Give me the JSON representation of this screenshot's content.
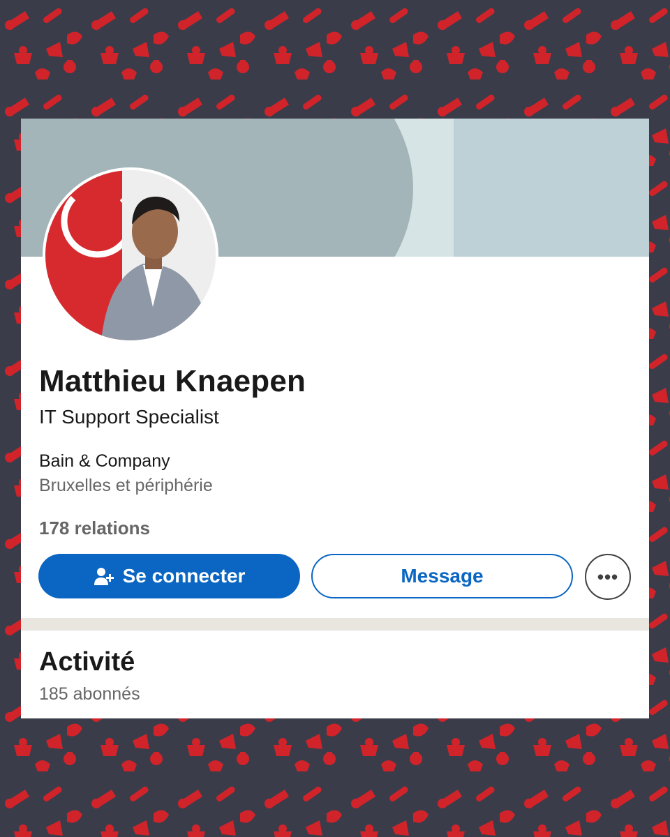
{
  "profile": {
    "name": "Matthieu Knaepen",
    "headline": "IT Support Specialist",
    "company": "Bain & Company",
    "location": "Bruxelles et périphérie",
    "connections": "178 relations"
  },
  "actions": {
    "connect_label": "Se connecter",
    "connect_icon": "add-person-icon",
    "message_label": "Message",
    "more_label": "•••",
    "more_icon": "more-options-icon"
  },
  "activity": {
    "title": "Activité",
    "followers": "185 abonnés"
  },
  "colors": {
    "background": "#3a3c4a",
    "pattern": "#d1232a",
    "primary": "#0a66c2",
    "banner": "#bdd1d6"
  }
}
